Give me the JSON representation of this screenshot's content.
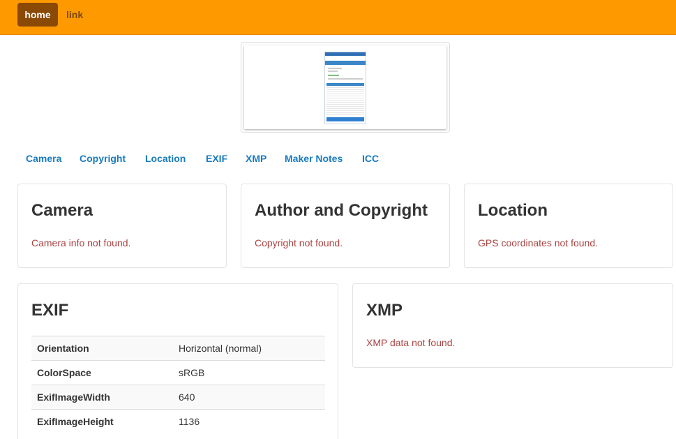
{
  "navbar": {
    "home_label": "home",
    "link_label": "link",
    "background": "#ff9900",
    "active_background": "#8a4a05"
  },
  "section_nav": {
    "items": [
      "Camera",
      "Copyright",
      "Location",
      "EXIF",
      "XMP",
      "Maker Notes",
      "ICC"
    ]
  },
  "panels": {
    "camera": {
      "title": "Camera",
      "message": "Camera info not found."
    },
    "copyright": {
      "title": "Author and Copyright",
      "message": "Copyright not found."
    },
    "location": {
      "title": "Location",
      "message": "GPS coordinates not found."
    },
    "exif": {
      "title": "EXIF",
      "rows": [
        {
          "key": "Orientation",
          "value": "Horizontal (normal)"
        },
        {
          "key": "ColorSpace",
          "value": "sRGB"
        },
        {
          "key": "ExifImageWidth",
          "value": "640"
        },
        {
          "key": "ExifImageHeight",
          "value": "1136"
        }
      ]
    },
    "xmp": {
      "title": "XMP",
      "message": "XMP data not found."
    }
  },
  "colors": {
    "link": "#1a7bbf",
    "error_text": "#a94442"
  }
}
